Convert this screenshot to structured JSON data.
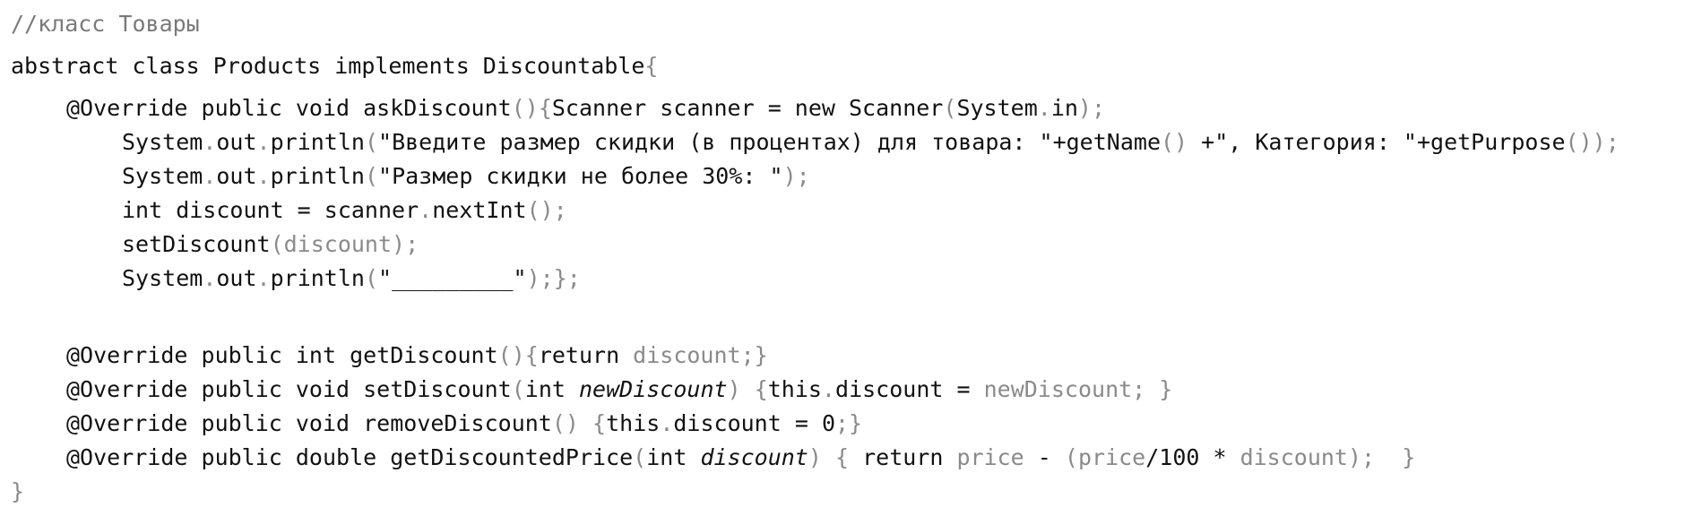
{
  "code_lines": [
    {
      "segments": [
        {
          "text": "//класс Товары",
          "style": "comment"
        }
      ]
    },
    {
      "segments": [
        {
          "text": "abstract class Products implements Discountable"
        },
        {
          "text": "{",
          "style": "g"
        }
      ]
    },
    {
      "segments": [
        {
          "text": "@Override public void askDiscount"
        },
        {
          "text": "()",
          "style": "g"
        },
        {
          "text": "{",
          "style": "g"
        },
        {
          "text": "Scanner scanner = new Scanner"
        },
        {
          "text": "(",
          "style": "g"
        },
        {
          "text": "System"
        },
        {
          "text": ".",
          "style": "g"
        },
        {
          "text": "in"
        },
        {
          "text": ");",
          "style": "g"
        }
      ]
    },
    {
      "segments": [
        {
          "text": "System"
        },
        {
          "text": ".",
          "style": "g"
        },
        {
          "text": "out"
        },
        {
          "text": ".",
          "style": "g"
        },
        {
          "text": "println"
        },
        {
          "text": "(",
          "style": "g"
        },
        {
          "text": "\"Введите размер скидки (в процентах) для товара: \"+getName"
        },
        {
          "text": "()",
          "style": "g"
        },
        {
          "text": " +\", Категория: \"+getPurpose"
        },
        {
          "text": "());",
          "style": "g"
        }
      ]
    },
    {
      "segments": [
        {
          "text": "System"
        },
        {
          "text": ".",
          "style": "g"
        },
        {
          "text": "out"
        },
        {
          "text": ".",
          "style": "g"
        },
        {
          "text": "println"
        },
        {
          "text": "(",
          "style": "g"
        },
        {
          "text": "\"Размер скидки не более 30%: \""
        },
        {
          "text": ");",
          "style": "g"
        }
      ]
    },
    {
      "segments": [
        {
          "text": "int discount = scanner"
        },
        {
          "text": ".",
          "style": "g"
        },
        {
          "text": "nextInt"
        },
        {
          "text": "();",
          "style": "g"
        }
      ]
    },
    {
      "segments": [
        {
          "text": "setDiscount"
        },
        {
          "text": "(discount);",
          "style": "g"
        }
      ]
    },
    {
      "segments": [
        {
          "text": "System"
        },
        {
          "text": ".",
          "style": "g"
        },
        {
          "text": "out"
        },
        {
          "text": ".",
          "style": "g"
        },
        {
          "text": "println"
        },
        {
          "text": "(",
          "style": "g"
        },
        {
          "text": "\"_________\""
        },
        {
          "text": ");};",
          "style": "g"
        }
      ]
    },
    {
      "segments": []
    },
    {
      "segments": [
        {
          "text": "@Override public int getDiscount"
        },
        {
          "text": "()",
          "style": "g"
        },
        {
          "text": "{",
          "style": "g"
        },
        {
          "text": "return "
        },
        {
          "text": "discount;}",
          "style": "g"
        }
      ]
    },
    {
      "segments": [
        {
          "text": "@Override public void setDiscount"
        },
        {
          "text": "(",
          "style": "g"
        },
        {
          "text": "int "
        },
        {
          "text": "newDiscount",
          "style": "i"
        },
        {
          "text": ")",
          "style": "g"
        },
        {
          "text": " "
        },
        {
          "text": "{",
          "style": "g"
        },
        {
          "text": "this"
        },
        {
          "text": ".",
          "style": "g"
        },
        {
          "text": "discount = "
        },
        {
          "text": "newDiscount; }",
          "style": "g"
        }
      ]
    },
    {
      "segments": [
        {
          "text": "@Override public void removeDiscount"
        },
        {
          "text": "()",
          "style": "g"
        },
        {
          "text": " "
        },
        {
          "text": "{",
          "style": "g"
        },
        {
          "text": "this"
        },
        {
          "text": ".",
          "style": "g"
        },
        {
          "text": "discount = 0"
        },
        {
          "text": ";}",
          "style": "g"
        }
      ]
    },
    {
      "segments": [
        {
          "text": "@Override public double getDiscountedPrice"
        },
        {
          "text": "(",
          "style": "g"
        },
        {
          "text": "int "
        },
        {
          "text": "discount",
          "style": "i"
        },
        {
          "text": ")",
          "style": "g"
        },
        {
          "text": " "
        },
        {
          "text": "{",
          "style": "g"
        },
        {
          "text": " return "
        },
        {
          "text": "price",
          "style": "g"
        },
        {
          "text": " - "
        },
        {
          "text": "(price",
          "style": "g"
        },
        {
          "text": "/"
        },
        {
          "text": "100 * "
        },
        {
          "text": "discount);  }",
          "style": "g"
        }
      ]
    },
    {
      "segments": [
        {
          "text": "}",
          "style": "g"
        }
      ]
    }
  ]
}
